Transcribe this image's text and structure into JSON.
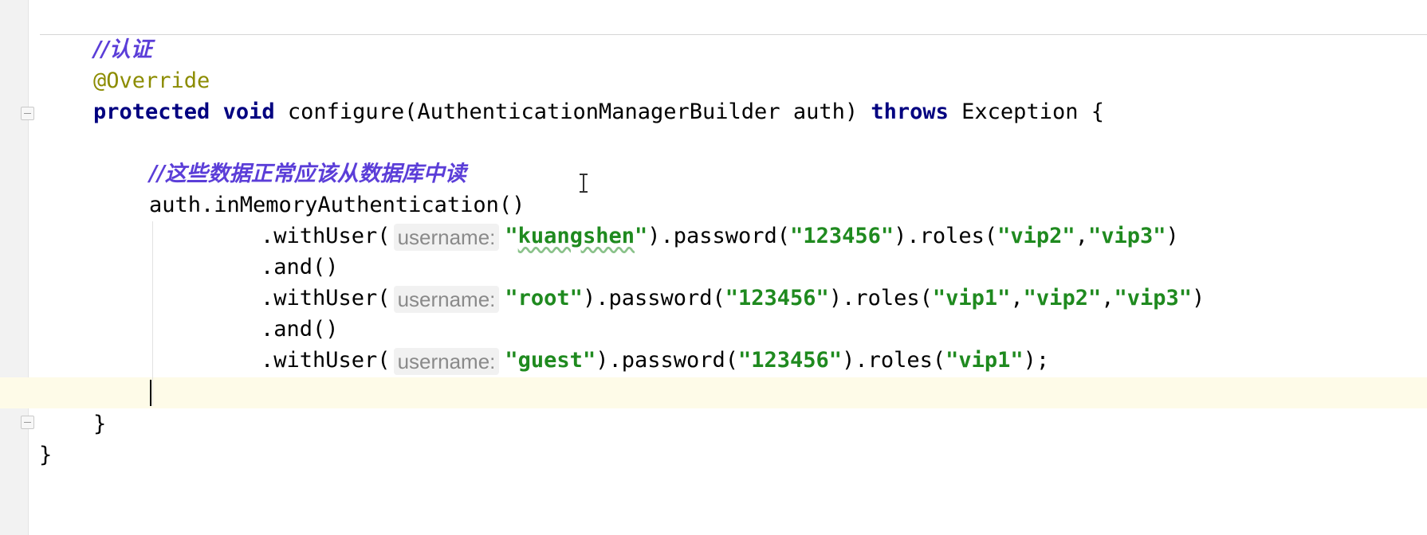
{
  "editor": {
    "lines": [
      {
        "id": "comment-auth",
        "tokens": [
          {
            "type": "comment",
            "text": "//认证"
          }
        ]
      },
      {
        "id": "annotation",
        "tokens": [
          {
            "type": "annotation",
            "text": "@Override"
          }
        ]
      },
      {
        "id": "signature",
        "tokens": [
          {
            "type": "keyword",
            "text": "protected"
          },
          {
            "type": "plain",
            "text": " "
          },
          {
            "type": "keyword",
            "text": "void"
          },
          {
            "type": "plain",
            "text": " configure(AuthenticationManagerBuilder auth) "
          },
          {
            "type": "keyword",
            "text": "throws"
          },
          {
            "type": "plain",
            "text": " Exception {"
          }
        ]
      },
      {
        "id": "comment-db",
        "tokens": [
          {
            "type": "comment",
            "text": "//这些数据正常应该从数据库中读"
          }
        ]
      },
      {
        "id": "in-memory",
        "tokens": [
          {
            "type": "plain",
            "text": "auth.inMemoryAuthentication()"
          }
        ]
      },
      {
        "id": "with-user-1",
        "tokens": [
          {
            "type": "plain",
            "text": ".withUser("
          },
          {
            "type": "hint",
            "text": "username:"
          },
          {
            "type": "string",
            "text": "\""
          },
          {
            "type": "string-squiggle",
            "text": "kuangshen"
          },
          {
            "type": "string",
            "text": "\""
          },
          {
            "type": "plain",
            "text": ").password("
          },
          {
            "type": "string",
            "text": "\"123456\""
          },
          {
            "type": "plain",
            "text": ").roles("
          },
          {
            "type": "string",
            "text": "\"vip2\""
          },
          {
            "type": "plain",
            "text": ","
          },
          {
            "type": "string",
            "text": "\"vip3\""
          },
          {
            "type": "plain",
            "text": ")"
          }
        ]
      },
      {
        "id": "and-1",
        "tokens": [
          {
            "type": "plain",
            "text": ".and()"
          }
        ]
      },
      {
        "id": "with-user-2",
        "tokens": [
          {
            "type": "plain",
            "text": ".withUser("
          },
          {
            "type": "hint",
            "text": "username:"
          },
          {
            "type": "string",
            "text": "\"root\""
          },
          {
            "type": "plain",
            "text": ").password("
          },
          {
            "type": "string",
            "text": "\"123456\""
          },
          {
            "type": "plain",
            "text": ").roles("
          },
          {
            "type": "string",
            "text": "\"vip1\""
          },
          {
            "type": "plain",
            "text": ","
          },
          {
            "type": "string",
            "text": "\"vip2\""
          },
          {
            "type": "plain",
            "text": ","
          },
          {
            "type": "string",
            "text": "\"vip3\""
          },
          {
            "type": "plain",
            "text": ")"
          }
        ]
      },
      {
        "id": "and-2",
        "tokens": [
          {
            "type": "plain",
            "text": ".and()"
          }
        ]
      },
      {
        "id": "with-user-3",
        "tokens": [
          {
            "type": "plain",
            "text": ".withUser("
          },
          {
            "type": "hint",
            "text": "username:"
          },
          {
            "type": "string",
            "text": "\"guest\""
          },
          {
            "type": "plain",
            "text": ").password("
          },
          {
            "type": "string",
            "text": "\"123456\""
          },
          {
            "type": "plain",
            "text": ").roles("
          },
          {
            "type": "string",
            "text": "\"vip1\""
          },
          {
            "type": "plain",
            "text": ");"
          }
        ]
      },
      {
        "id": "empty-caret",
        "tokens": []
      },
      {
        "id": "close-method",
        "tokens": [
          {
            "type": "plain",
            "text": "}"
          }
        ]
      },
      {
        "id": "close-class",
        "tokens": [
          {
            "type": "plain",
            "text": "}"
          }
        ]
      }
    ]
  },
  "colors": {
    "keyword": "#000080",
    "string": "#1f8a1f",
    "comment": "#5b3ed8",
    "annotation": "#8c8c00",
    "hint": "#8a8a8a",
    "caret_row": "#fefbe8"
  },
  "icons": {
    "fold_markers": [
      "fold-icon",
      "fold-icon"
    ],
    "mouse_pointer": "text-ibeam-cursor"
  }
}
